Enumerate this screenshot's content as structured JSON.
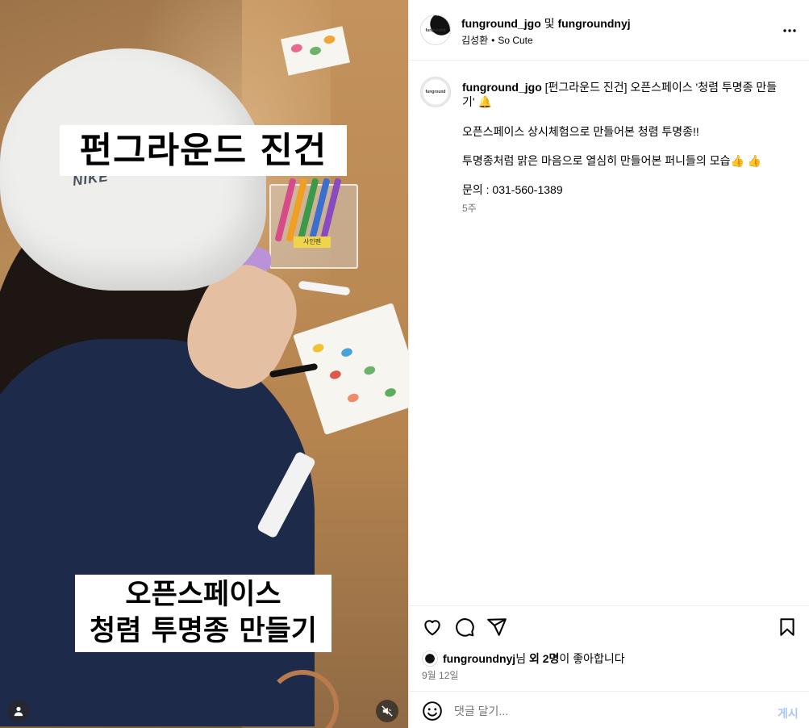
{
  "media": {
    "overlay_top": "펀그라운드 진건",
    "overlay_bottom_line1": "오픈스페이스",
    "overlay_bottom_line2": "청렴 투명종 만들기",
    "cap_logo": "NIKE",
    "box_label": "사인펜",
    "user_icon": "user-icon",
    "mute_icon": "muted-speaker-icon"
  },
  "header": {
    "user1": "funground_jgo",
    "conjunction": "및",
    "user2": "fungroundnyj",
    "sub_user": "김성환",
    "sub_separator": "•",
    "sub_audio": "So Cute",
    "more_icon": "more-horizontal-icon"
  },
  "caption": {
    "username": "funground_jgo",
    "title": "[펀그라운드 진건] 오픈스페이스 '청렴 투명종 만들기' 🔔",
    "line1": "오픈스페이스 상시체험으로 만들어본 청렴 투명종!!",
    "line2": "투명종처럼 맑은 마음으로 열심히 만들어본 퍼니들의 모습👍 👍",
    "line3": "문의 : 031-560-1389",
    "time": "5주"
  },
  "actions": {
    "like_icon": "heart-icon",
    "comment_icon": "comment-icon",
    "share_icon": "send-icon",
    "save_icon": "bookmark-icon",
    "likes_user": "fungroundnyj",
    "likes_mid": "님",
    "likes_others": "외 2명",
    "likes_suffix": "이 좋아합니다",
    "date": "9월 12일"
  },
  "comment": {
    "placeholder": "댓글 달기...",
    "post_label": "게시",
    "emoji_icon": "emoji-icon"
  },
  "colors": {
    "accent": "#0095f6",
    "post_button_disabled": "#a9c7f4",
    "secondary_text": "#737373",
    "border": "#efefef"
  }
}
